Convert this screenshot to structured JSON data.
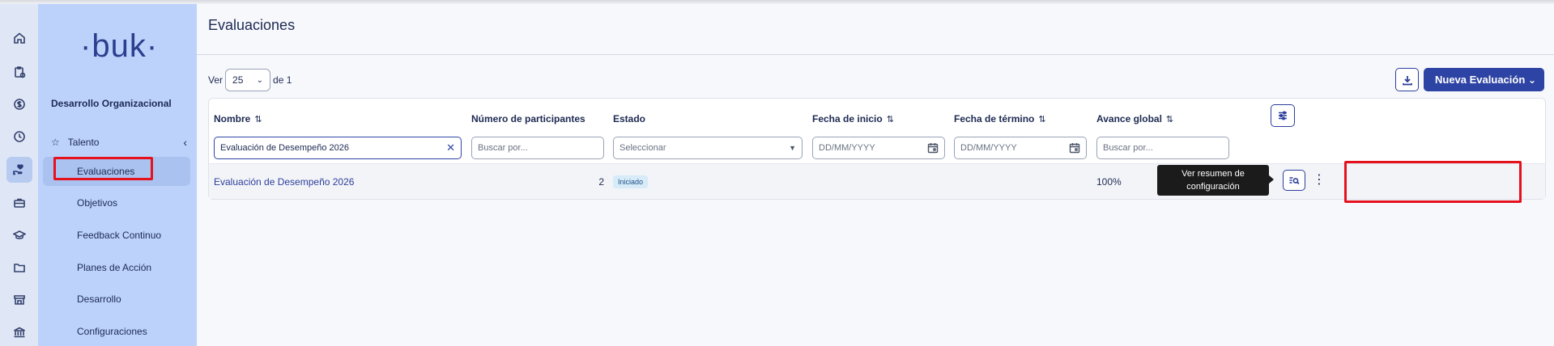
{
  "app": {
    "logo_text": "·buk·"
  },
  "rail": {
    "icons": [
      "home-icon",
      "clipboard-clock-icon",
      "dollar-icon",
      "clock-icon",
      "hand-heart-icon",
      "briefcase-icon",
      "graduation-cap-icon",
      "folder-icon",
      "store-icon",
      "bank-icon"
    ],
    "active_index": 4
  },
  "sidebar": {
    "section_title": "Desarrollo Organizacional",
    "group_label": "Talento",
    "items": [
      {
        "label": "Evaluaciones",
        "active": true
      },
      {
        "label": "Objetivos"
      },
      {
        "label": "Feedback Continuo"
      },
      {
        "label": "Planes de Acción"
      },
      {
        "label": "Desarrollo"
      },
      {
        "label": "Configuraciones"
      }
    ]
  },
  "main": {
    "page_title": "Evaluaciones",
    "pagination": {
      "ver_label": "Ver",
      "page_size": "25",
      "of_label": "de 1"
    },
    "new_button_label": "Nueva Evaluación",
    "table": {
      "columns": [
        {
          "label": "Nombre",
          "sortable": true
        },
        {
          "label": "Número de participantes",
          "sortable": false
        },
        {
          "label": "Estado",
          "sortable": false
        },
        {
          "label": "Fecha de inicio",
          "sortable": true
        },
        {
          "label": "Fecha de término",
          "sortable": true
        },
        {
          "label": "Avance global",
          "sortable": true
        }
      ],
      "filters": {
        "nombre_value": "Evaluación de Desempeño 2026",
        "participantes_placeholder": "Buscar por...",
        "estado_placeholder": "Seleccionar",
        "inicio_placeholder": "DD/MM/YYYY",
        "termino_placeholder": "DD/MM/YYYY",
        "avance_placeholder": "Buscar por..."
      },
      "rows": [
        {
          "nombre": "Evaluación de Desempeño 2026",
          "participantes": "2",
          "estado": "Iniciado",
          "avance": "100%"
        }
      ]
    },
    "tooltip": {
      "line1": "Ver resumen de",
      "line2": "configuración"
    }
  },
  "colors": {
    "primary": "#2e44a4",
    "sidebar_bg": "#bcd2fb",
    "highlight": "#e5121e"
  }
}
